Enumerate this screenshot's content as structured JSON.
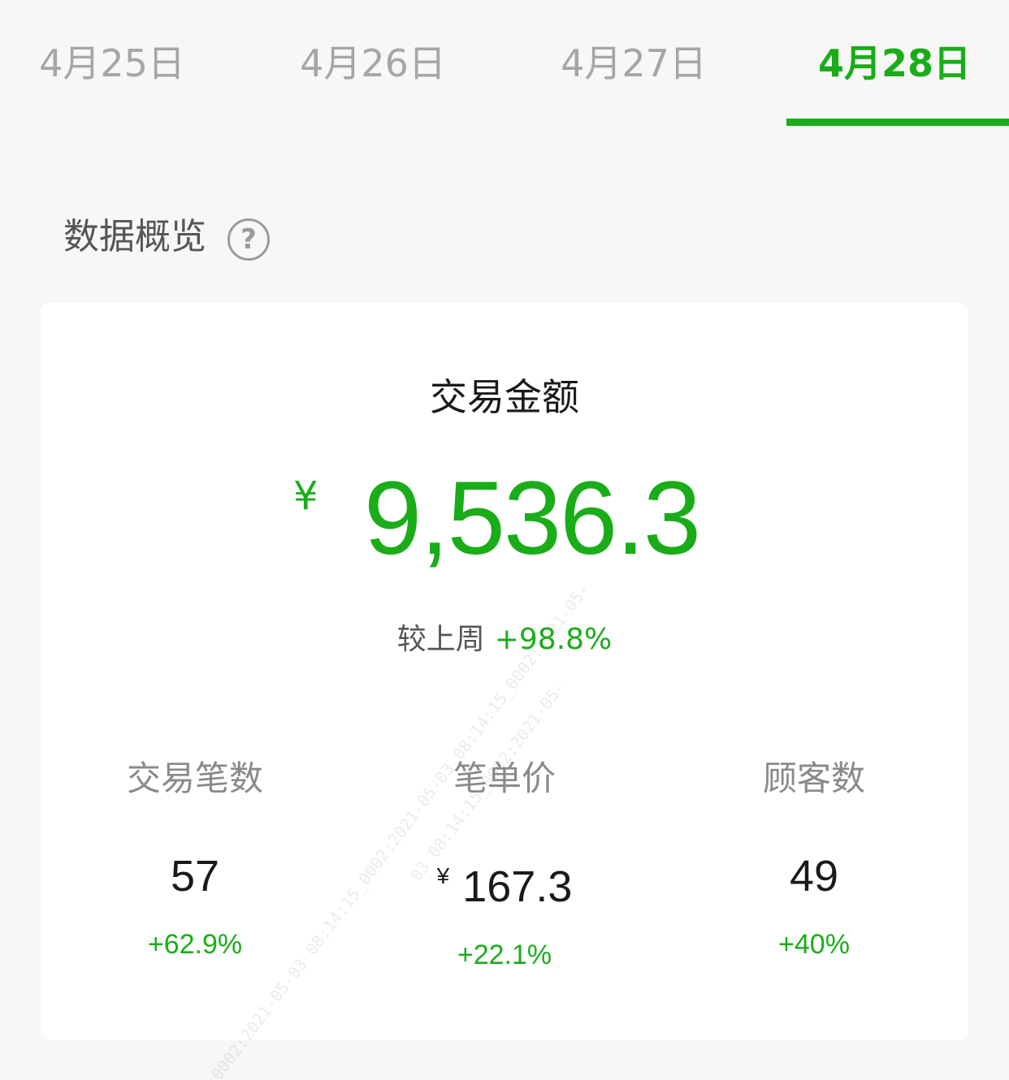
{
  "tabs": [
    {
      "label": "4月25日",
      "active": false
    },
    {
      "label": "4月26日",
      "active": false
    },
    {
      "label": "4月27日",
      "active": false
    },
    {
      "label": "4月28日",
      "active": true
    }
  ],
  "section": {
    "title": "数据概览",
    "help_icon": "question-circle-icon",
    "help_glyph": "?"
  },
  "overview": {
    "title": "交易金额",
    "currency": "¥",
    "amount": "9,536.3",
    "compare_label": "较上周",
    "compare_value": "+98.8%"
  },
  "stats": [
    {
      "label": "交易笔数",
      "currency": "",
      "value": "57",
      "change": "+62.9%"
    },
    {
      "label": "笔单价",
      "currency": "¥",
      "value": "167.3",
      "change": "+22.1%"
    },
    {
      "label": "顾客数",
      "currency": "",
      "value": "49",
      "change": "+40%"
    }
  ],
  "watermark": {
    "line1": "0002:2021-05-03 08:14:15_0002:2021-05-03 08:14:15_0002:2021-05-",
    "line2": "03 08:14:15_0002:2021-05-"
  },
  "colors": {
    "accent": "#1aad19",
    "background": "#f7f7f7",
    "card": "#ffffff",
    "tab_inactive": "#a6a6a6"
  }
}
